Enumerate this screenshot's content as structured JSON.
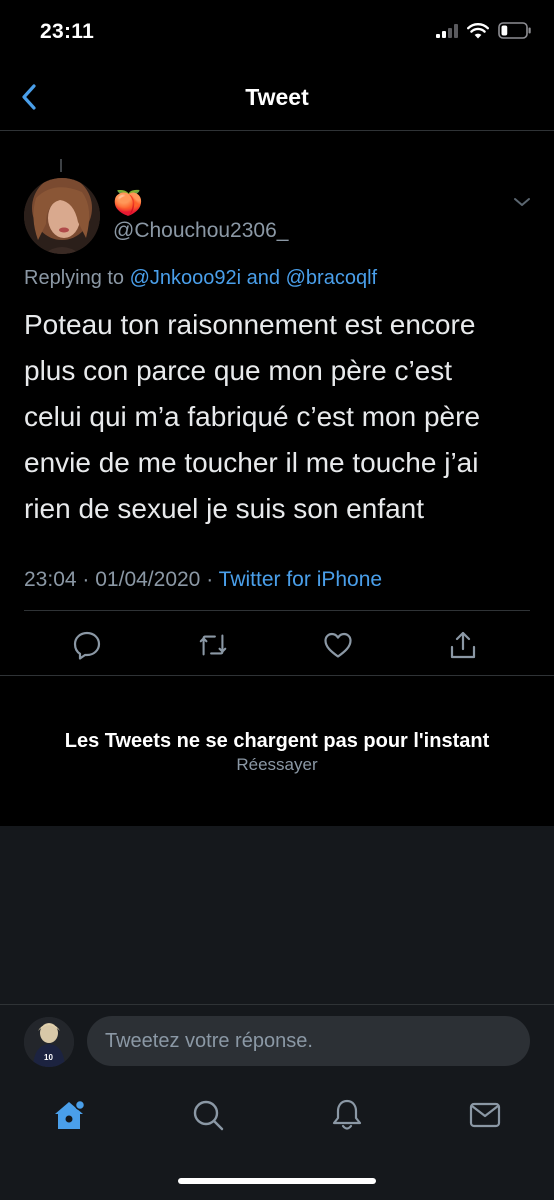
{
  "status_bar": {
    "time": "23:11",
    "battery_level": 0.25
  },
  "header": {
    "title": "Tweet"
  },
  "tweet": {
    "display_name": "🍑",
    "handle": "@Chouchou2306_",
    "replying_prefix": "Replying to",
    "replying_user_1": "@Jnkooo92i",
    "replying_and": "and",
    "replying_user_2": "@bracoqlf",
    "text": "Poteau ton raisonnement est encore\nplus con parce que mon père c’est\ncelui qui m’a fabriqué c’est mon père\nenvie de me toucher il me touche j’ai\nrien de sexuel je suis son enfant",
    "time": "23:04",
    "separator_1": "·",
    "date": "01/04/2020",
    "separator_2": "·",
    "source": "Twitter for iPhone"
  },
  "error": {
    "title": "Les Tweets ne se chargent pas pour l'instant",
    "retry": "Réessayer"
  },
  "composer": {
    "placeholder": "Tweetez votre réponse."
  },
  "colors": {
    "accent": "#4a9fea",
    "background": "#000000",
    "secondary_text": "#8b98a5",
    "divider": "#2f3336",
    "panel": "#15181c"
  }
}
